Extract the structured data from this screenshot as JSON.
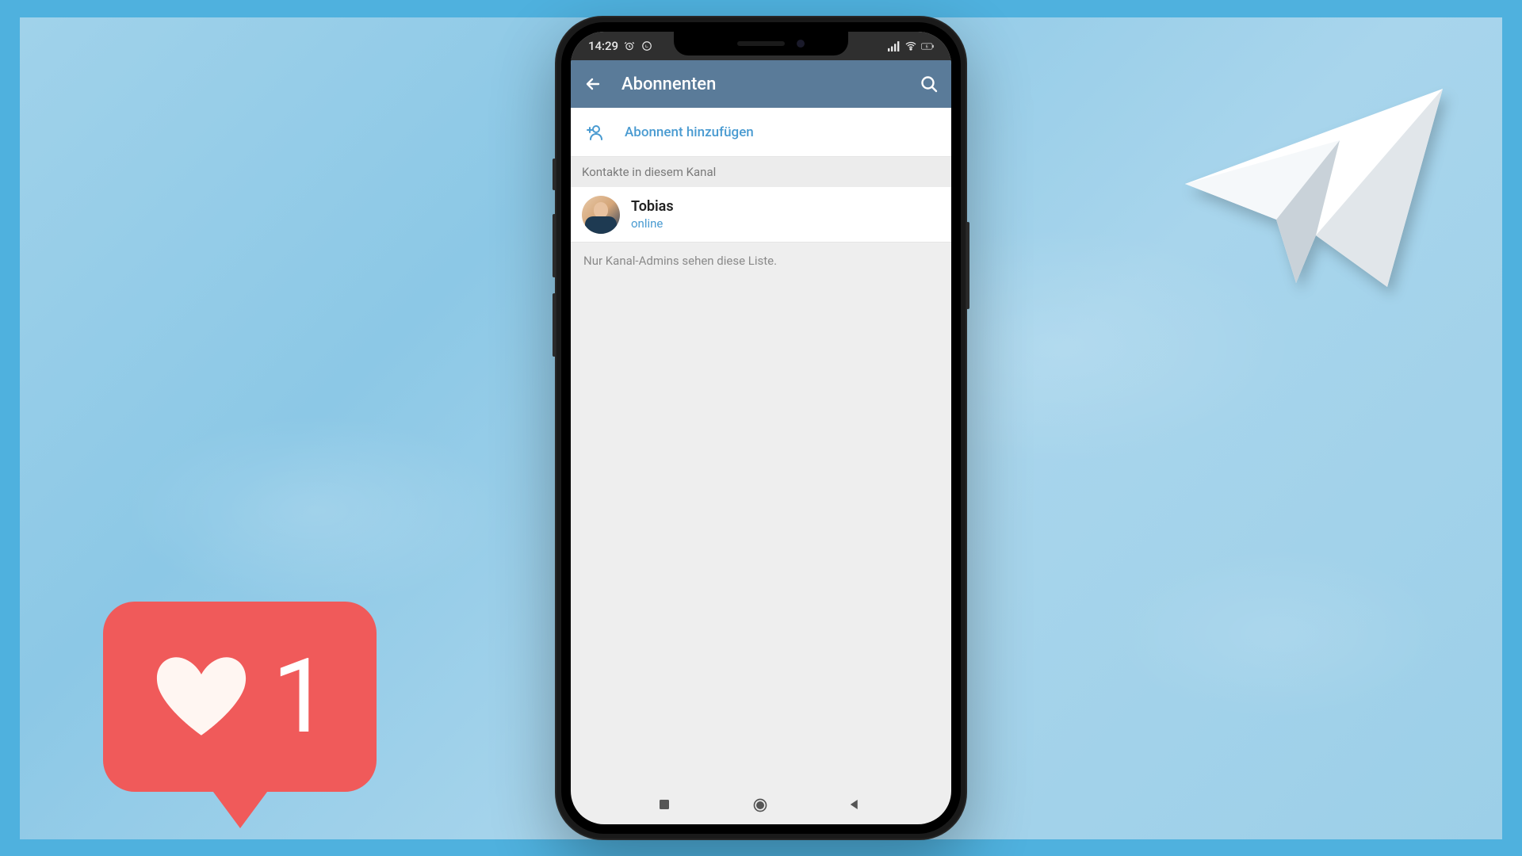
{
  "statusbar": {
    "time": "14:29"
  },
  "appbar": {
    "title": "Abonnenten"
  },
  "add_subscriber": {
    "label": "Abonnent hinzufügen"
  },
  "section": {
    "header": "Kontakte in diesem Kanal"
  },
  "contacts": [
    {
      "name": "Tobias",
      "status": "online"
    }
  ],
  "hint": "Nur Kanal-Admins sehen diese Liste.",
  "like": {
    "count": "1"
  }
}
